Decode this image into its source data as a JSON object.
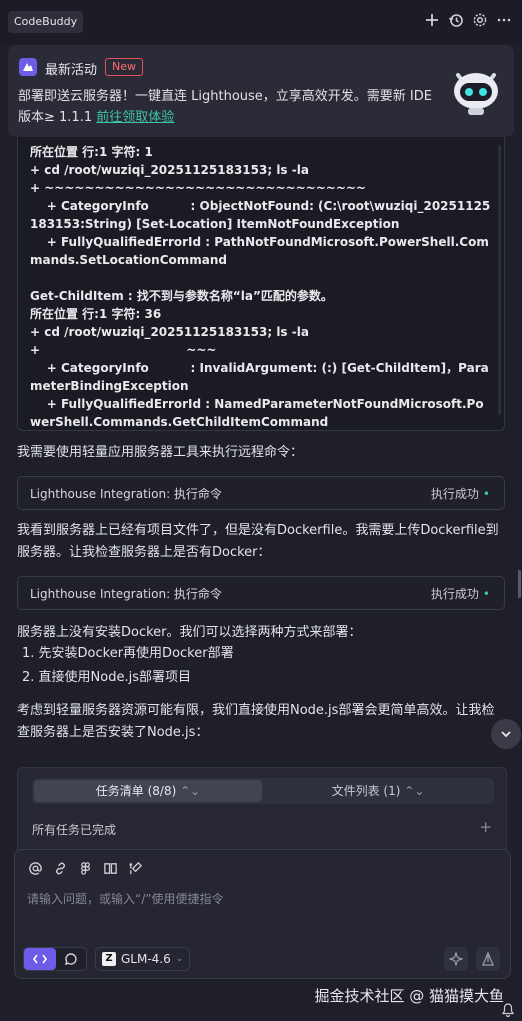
{
  "app": {
    "tab_label": "CodeBuddy"
  },
  "header_icons": [
    "plus-icon",
    "history-icon",
    "settings-icon",
    "more-icon"
  ],
  "announcement": {
    "title": "最新活动",
    "badge": "New",
    "message": "部署即送云服务器！一键直连 Lighthouse，立享高效开发。需要新 IDE 版本≥ 1.1.1 ",
    "link": "前往领取体验"
  },
  "terminal": {
    "lines": [
      "所在位置 行:1 字符: 1",
      "+ cd /root/wuziqi_20251125183153; ls -la",
      "+ ~~~~~~~~~~~~~~~~~~~~~~~~~~~~~~~~",
      "    + CategoryInfo          : ObjectNotFound: (C:\\root\\wuziqi_20251125183153:String) [Set-Location] ItemNotFoundException",
      "    + FullyQualifiedErrorId : PathNotFoundMicrosoft.PowerShell.Commands.SetLocationCommand",
      "",
      "Get-ChildItem : 找不到与参数名称“la”匹配的参数。",
      "所在位置 行:1 字符: 36",
      "+ cd /root/wuziqi_20251125183153; ls -la",
      "+                                   ~~~",
      "    + CategoryInfo          : InvalidArgument: (:) [Get-ChildItem]，ParameterBindingException",
      "    + FullyQualifiedErrorId : NamedParameterNotFoundMicrosoft.PowerShell.Commands.GetChildItemCommand"
    ]
  },
  "chat": {
    "msg1": "我需要使用轻量应用服务器工具来执行远程命令：",
    "tool1": {
      "name": "Lighthouse Integration: 执行命令",
      "status": "执行成功"
    },
    "msg2": "我看到服务器上已经有项目文件了，但是没有Dockerfile。我需要上传Dockerfile到服务器。让我检查服务器上是否有Docker：",
    "tool2": {
      "name": "Lighthouse Integration: 执行命令",
      "status": "执行成功"
    },
    "msg3": "服务器上没有安装Docker。我们可以选择两种方式来部署：",
    "options": [
      "1. 先安装Docker再使用Docker部署",
      "2. 直接使用Node.js部署项目"
    ],
    "msg4": "考虑到轻量服务器资源可能有限，我们直接使用Node.js部署会更简单高效。让我检查服务器上是否安装了Node.js："
  },
  "tasks": {
    "tab_tasks": "任务清单 (8/8)",
    "tab_files": "文件列表 (1)",
    "status": "所有任务已完成"
  },
  "input": {
    "placeholder": "请输入问题，或输入“/”使用便捷指令",
    "model": "GLM-4.6"
  },
  "watermark": "掘金技术社区 @ 猫猫摸大鱼"
}
